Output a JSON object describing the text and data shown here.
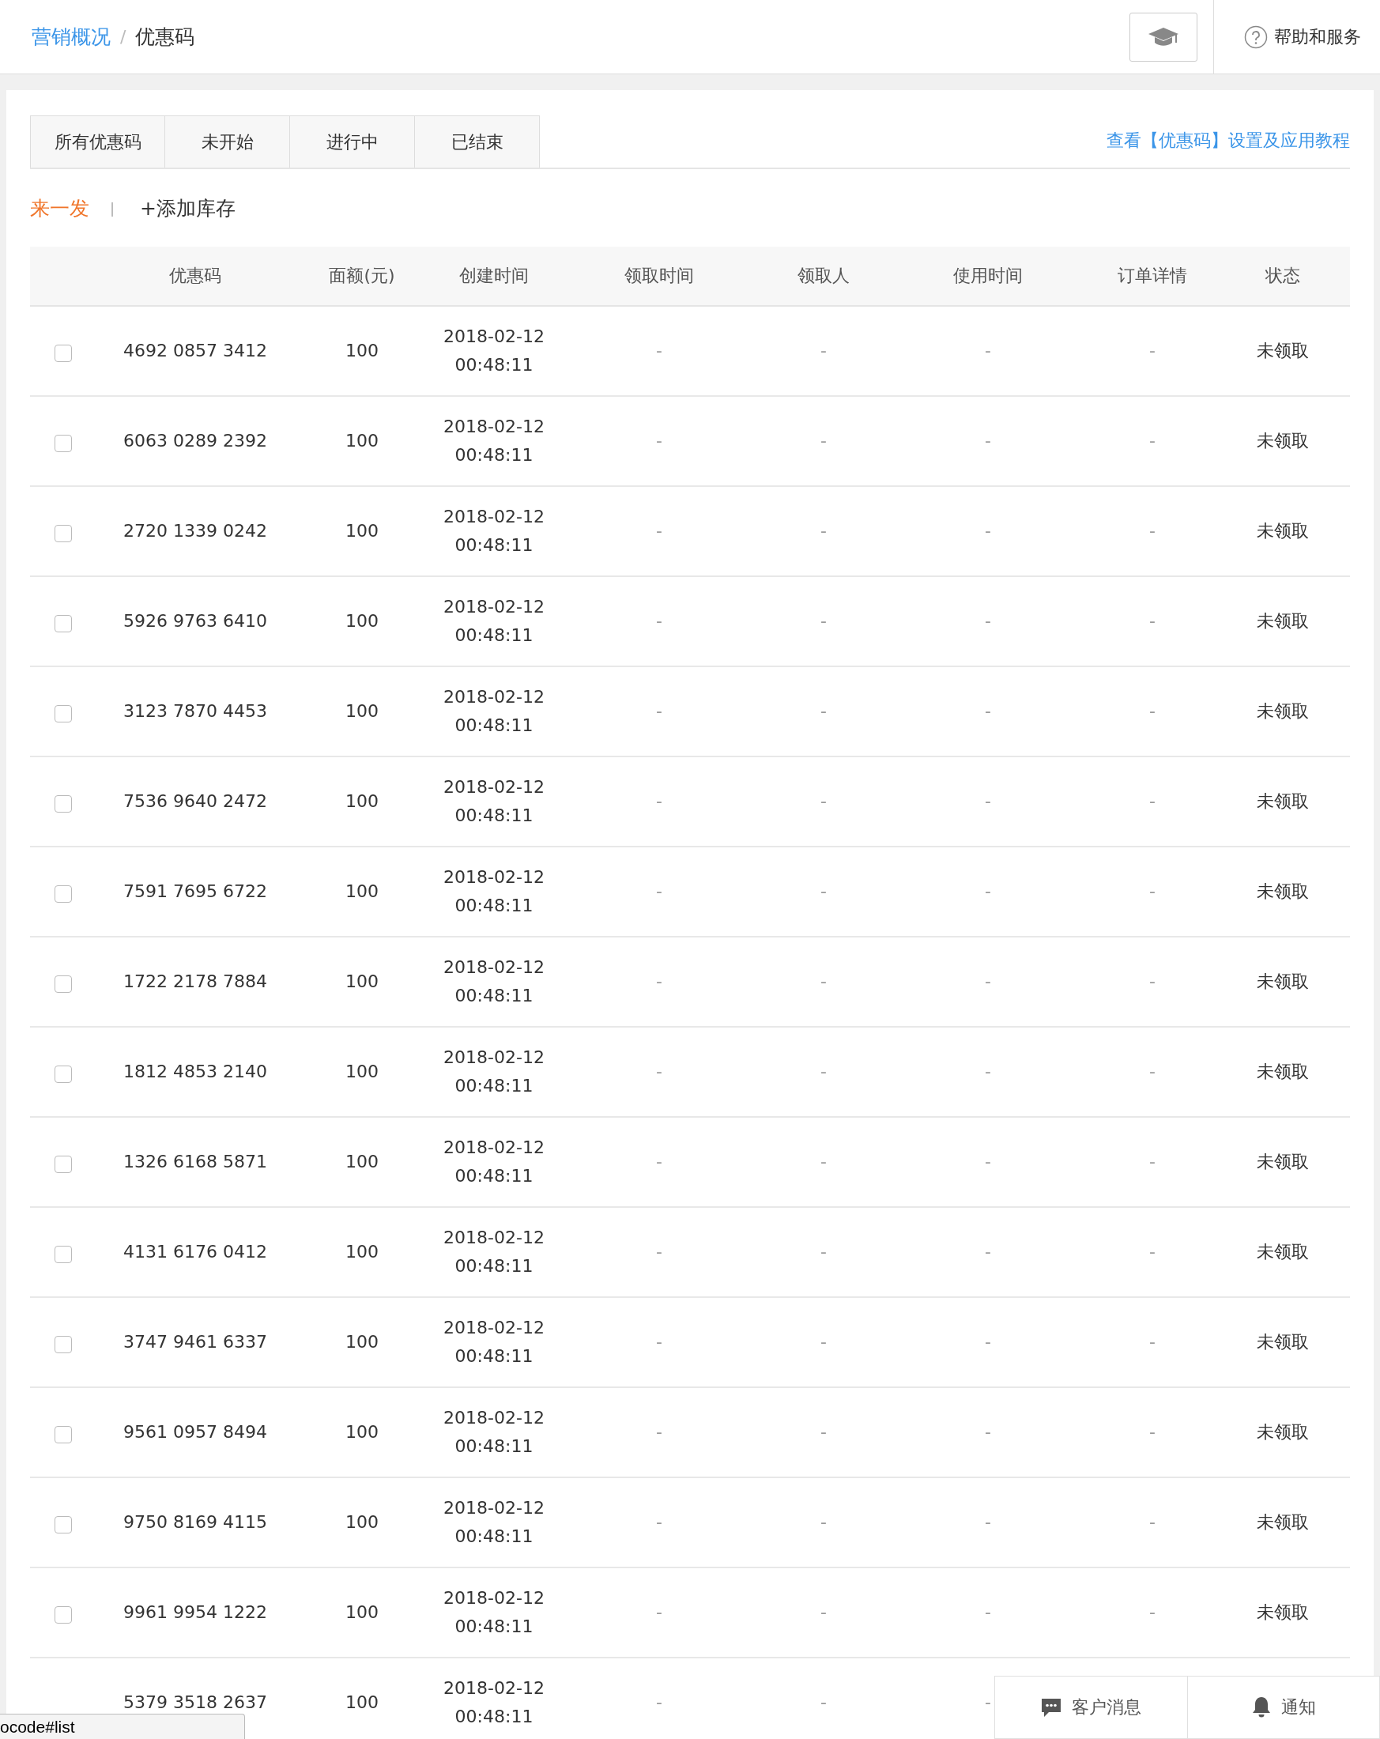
{
  "breadcrumb": [
    {
      "label": "营销概况",
      "kind": "link"
    },
    {
      "label": "/",
      "kind": "separator"
    },
    {
      "label": "优惠码",
      "kind": "current"
    }
  ],
  "header": {
    "help": "帮助和服务"
  },
  "tabs": [
    {
      "label": "所有优惠码",
      "selected": false
    },
    {
      "label": "未开始",
      "selected": false
    },
    {
      "label": "进行中",
      "selected": false
    },
    {
      "label": "已结束",
      "selected": false
    }
  ],
  "tutorial_link": "查看【优惠码】设置及应用教程",
  "actions": {
    "primary": "来一发",
    "separator": "|",
    "secondary": "+添加库存"
  },
  "table": {
    "columns": [
      "优惠码",
      "面额(元)",
      "创建时间",
      "领取时间",
      "领取人",
      "使用时间",
      "订单详情",
      "状态"
    ],
    "rows": [
      {
        "checked": false,
        "cells": [
          "4692 0857 3412",
          "100",
          "2018-02-12 00:48:11",
          "-",
          "-",
          "-",
          "-",
          "未领取"
        ]
      },
      {
        "checked": false,
        "cells": [
          "6063 0289 2392",
          "100",
          "2018-02-12 00:48:11",
          "-",
          "-",
          "-",
          "-",
          "未领取"
        ]
      },
      {
        "checked": false,
        "cells": [
          "2720 1339 0242",
          "100",
          "2018-02-12 00:48:11",
          "-",
          "-",
          "-",
          "-",
          "未领取"
        ]
      },
      {
        "checked": false,
        "cells": [
          "5926 9763 6410",
          "100",
          "2018-02-12 00:48:11",
          "-",
          "-",
          "-",
          "-",
          "未领取"
        ]
      },
      {
        "checked": false,
        "cells": [
          "3123 7870 4453",
          "100",
          "2018-02-12 00:48:11",
          "-",
          "-",
          "-",
          "-",
          "未领取"
        ]
      },
      {
        "checked": false,
        "cells": [
          "7536 9640 2472",
          "100",
          "2018-02-12 00:48:11",
          "-",
          "-",
          "-",
          "-",
          "未领取"
        ]
      },
      {
        "checked": false,
        "cells": [
          "7591 7695 6722",
          "100",
          "2018-02-12 00:48:11",
          "-",
          "-",
          "-",
          "-",
          "未领取"
        ]
      },
      {
        "checked": false,
        "cells": [
          "1722 2178 7884",
          "100",
          "2018-02-12 00:48:11",
          "-",
          "-",
          "-",
          "-",
          "未领取"
        ]
      },
      {
        "checked": false,
        "cells": [
          "1812 4853 2140",
          "100",
          "2018-02-12 00:48:11",
          "-",
          "-",
          "-",
          "-",
          "未领取"
        ]
      },
      {
        "checked": false,
        "cells": [
          "1326 6168 5871",
          "100",
          "2018-02-12 00:48:11",
          "-",
          "-",
          "-",
          "-",
          "未领取"
        ]
      },
      {
        "checked": false,
        "cells": [
          "4131 6176 0412",
          "100",
          "2018-02-12 00:48:11",
          "-",
          "-",
          "-",
          "-",
          "未领取"
        ]
      },
      {
        "checked": false,
        "cells": [
          "3747 9461 6337",
          "100",
          "2018-02-12 00:48:11",
          "-",
          "-",
          "-",
          "-",
          "未领取"
        ]
      },
      {
        "checked": false,
        "cells": [
          "9561 0957 8494",
          "100",
          "2018-02-12 00:48:11",
          "-",
          "-",
          "-",
          "-",
          "未领取"
        ]
      },
      {
        "checked": false,
        "cells": [
          "9750 8169 4115",
          "100",
          "2018-02-12 00:48:11",
          "-",
          "-",
          "-",
          "-",
          "未领取"
        ]
      },
      {
        "checked": false,
        "cells": [
          "9961 9954 1222",
          "100",
          "2018-02-12 00:48:11",
          "-",
          "-",
          "-",
          "-",
          "未领取"
        ]
      },
      {
        "cells": [
          "5379 3518 2637",
          "100",
          "2018-02-12 00:48:11",
          "-",
          "-",
          "-"
        ]
      }
    ]
  },
  "floating_panel": [
    {
      "kind": "chat",
      "label": "客户消息"
    },
    {
      "kind": "bell",
      "label": "通知"
    }
  ],
  "status_bar": "ocode#list"
}
